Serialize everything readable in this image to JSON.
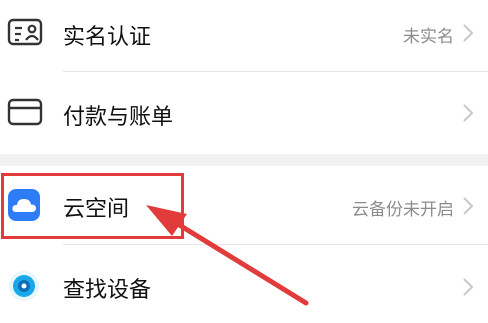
{
  "settings": {
    "items": [
      {
        "label": "实名认证",
        "value": "未实名",
        "icon": "id-card-icon"
      },
      {
        "label": "付款与账单",
        "value": "",
        "icon": "card-icon"
      },
      {
        "label": "云空间",
        "value": "云备份未开启",
        "icon": "cloud-icon"
      },
      {
        "label": "查找设备",
        "value": "",
        "icon": "locate-icon"
      }
    ]
  },
  "annotation": {
    "highlight_color": "#e23b3b"
  },
  "colors": {
    "cloud_icon": "#2f7df6",
    "locate_icon": "#1aa7e8",
    "chevron": "#c8c8c8"
  }
}
